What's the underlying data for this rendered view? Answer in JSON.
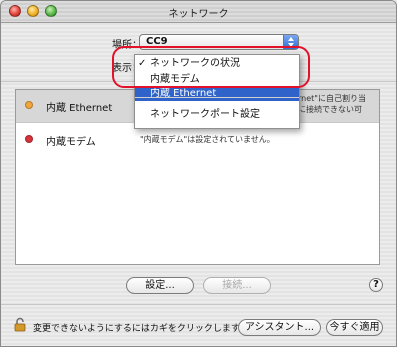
{
  "window": {
    "title": "ネットワーク"
  },
  "location": {
    "label": "場所：",
    "value": "CC9"
  },
  "show": {
    "label": "表示："
  },
  "menu": {
    "checked_mark": "✓",
    "items": [
      {
        "label": "ネットワークの状況",
        "checked": true
      },
      {
        "label": "内蔵モデム"
      },
      {
        "label": "内蔵 Ethernet",
        "highlighted": true
      },
      {
        "label": "ネットワークポート設定"
      }
    ]
  },
  "status_list": [
    {
      "name": "内蔵 Ethernet",
      "desc_line1": "rnet\"に自己割り当",
      "desc_line2": "に接続できない可",
      "status_color": "#f0a63a"
    },
    {
      "name": "内蔵モデム",
      "desc": "\"内蔵モデム\"は設定されていません。",
      "status_color": "#d8323a"
    }
  ],
  "buttons": {
    "configure": "設定...",
    "connect": "接続...",
    "help": "?",
    "assist": "アシスタント...",
    "apply": "今すぐ適用"
  },
  "lock": {
    "text": "変更できないようにするにはカギをクリックします。"
  }
}
